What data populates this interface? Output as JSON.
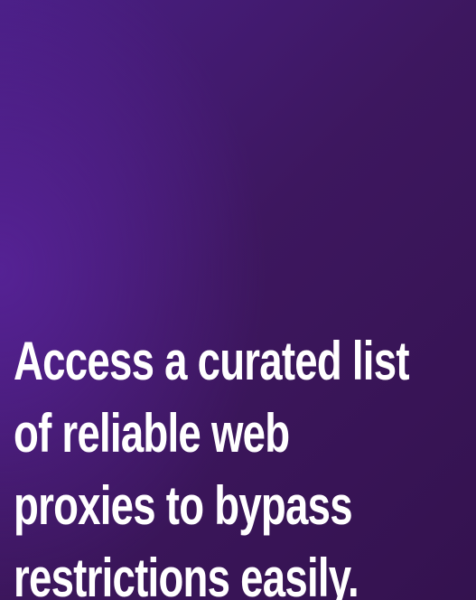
{
  "headline": {
    "lines": [
      "Access a curated list",
      "of reliable web",
      "proxies to bypass",
      "restrictions easily."
    ]
  }
}
